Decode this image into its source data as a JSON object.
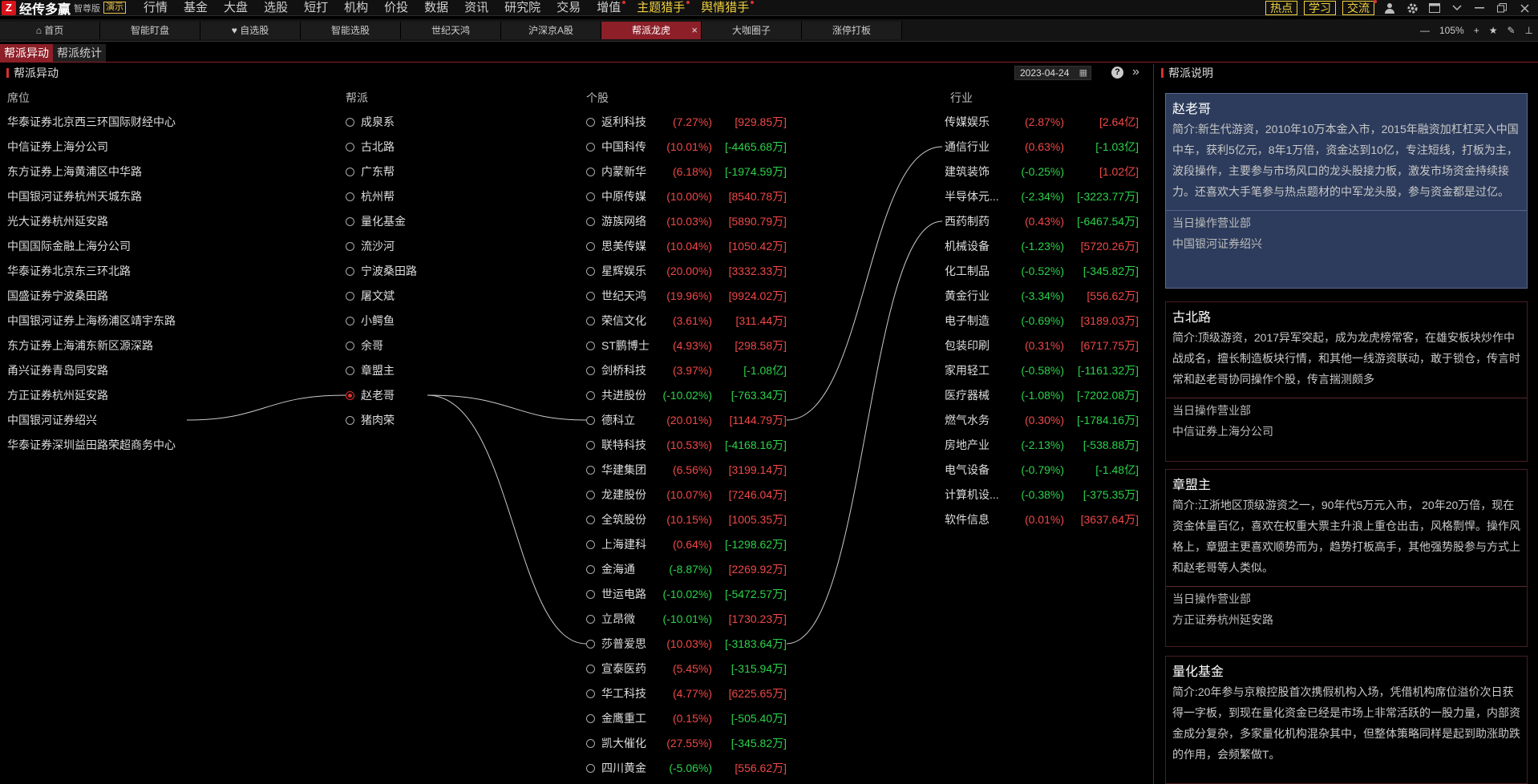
{
  "app": {
    "logo_mark": "Z",
    "name": "经传多赢",
    "edition": "智尊版",
    "demo": "演示"
  },
  "menu": [
    {
      "label": "行情",
      "yellow": false,
      "dot": false
    },
    {
      "label": "基金",
      "yellow": false,
      "dot": false
    },
    {
      "label": "大盘",
      "yellow": false,
      "dot": false
    },
    {
      "label": "选股",
      "yellow": false,
      "dot": false
    },
    {
      "label": "短打",
      "yellow": false,
      "dot": false
    },
    {
      "label": "机构",
      "yellow": false,
      "dot": false
    },
    {
      "label": "价投",
      "yellow": false,
      "dot": false
    },
    {
      "label": "数据",
      "yellow": false,
      "dot": false
    },
    {
      "label": "资讯",
      "yellow": false,
      "dot": false
    },
    {
      "label": "研究院",
      "yellow": false,
      "dot": false
    },
    {
      "label": "交易",
      "yellow": false,
      "dot": false
    },
    {
      "label": "增值",
      "yellow": false,
      "dot": true
    },
    {
      "label": "主题猎手",
      "yellow": true,
      "dot": true
    },
    {
      "label": "舆情猎手",
      "yellow": true,
      "dot": true
    }
  ],
  "top_right": {
    "pills": [
      "热点",
      "学习",
      "交流"
    ]
  },
  "tabs": [
    {
      "label": "首页",
      "icon": "home-icon"
    },
    {
      "label": "智能盯盘"
    },
    {
      "label": "自选股",
      "icon": "heart-icon"
    },
    {
      "label": "智能选股"
    },
    {
      "label": "世纪天鸿"
    },
    {
      "label": "沪深京A股"
    },
    {
      "label": "帮派龙虎",
      "active": true
    },
    {
      "label": "大咖圈子"
    },
    {
      "label": "涨停打板"
    }
  ],
  "zoom": {
    "value": "105%"
  },
  "subtabs": [
    "帮派异动",
    "帮派统计"
  ],
  "main": {
    "section_title": "帮派异动",
    "date": "2023-04-24",
    "help": "?",
    "columns": {
      "seat": "席位",
      "gang": "帮派",
      "stock": "个股",
      "industry": "行业"
    },
    "seats": [
      "华泰证券北京西三环国际财经中心",
      "中信证券上海分公司",
      "东方证券上海黄浦区中华路",
      "中国银河证券杭州天城东路",
      "光大证券杭州延安路",
      "中国国际金融上海分公司",
      "华泰证券北京东三环北路",
      "国盛证券宁波桑田路",
      "中国银河证券上海杨浦区靖宇东路",
      "东方证券上海浦东新区源深路",
      "甬兴证券青岛同安路",
      "方正证券杭州延安路",
      "中国银河证券绍兴",
      "华泰证券深圳益田路荣超商务中心"
    ],
    "gangs": [
      {
        "name": "成泉系",
        "selected": false
      },
      {
        "name": "古北路",
        "selected": false
      },
      {
        "name": "广东帮",
        "selected": false
      },
      {
        "name": "杭州帮",
        "selected": false
      },
      {
        "name": "量化基金",
        "selected": false
      },
      {
        "name": "流沙河",
        "selected": false
      },
      {
        "name": "宁波桑田路",
        "selected": false
      },
      {
        "name": "屠文斌",
        "selected": false
      },
      {
        "name": "小鳄鱼",
        "selected": false
      },
      {
        "name": "余哥",
        "selected": false
      },
      {
        "name": "章盟主",
        "selected": false
      },
      {
        "name": "赵老哥",
        "selected": true
      },
      {
        "name": "猪肉荣",
        "selected": false
      }
    ],
    "stocks": [
      {
        "name": "返利科技",
        "pct": "(7.27%)",
        "amt": "[929.85万]",
        "pct_color": "red",
        "amt_color": "red"
      },
      {
        "name": "中国科传",
        "pct": "(10.01%)",
        "amt": "[-4465.68万]",
        "pct_color": "red",
        "amt_color": "green"
      },
      {
        "name": "内蒙新华",
        "pct": "(6.18%)",
        "amt": "[-1974.59万]",
        "pct_color": "red",
        "amt_color": "green"
      },
      {
        "name": "中原传媒",
        "pct": "(10.00%)",
        "amt": "[8540.78万]",
        "pct_color": "red",
        "amt_color": "red"
      },
      {
        "name": "游族网络",
        "pct": "(10.03%)",
        "amt": "[5890.79万]",
        "pct_color": "red",
        "amt_color": "red"
      },
      {
        "name": "思美传媒",
        "pct": "(10.04%)",
        "amt": "[1050.42万]",
        "pct_color": "red",
        "amt_color": "red"
      },
      {
        "name": "星辉娱乐",
        "pct": "(20.00%)",
        "amt": "[3332.33万]",
        "pct_color": "red",
        "amt_color": "red"
      },
      {
        "name": "世纪天鸿",
        "pct": "(19.96%)",
        "amt": "[9924.02万]",
        "pct_color": "red",
        "amt_color": "red"
      },
      {
        "name": "荣信文化",
        "pct": "(3.61%)",
        "amt": "[311.44万]",
        "pct_color": "red",
        "amt_color": "red"
      },
      {
        "name": "ST鹏博士",
        "pct": "(4.93%)",
        "amt": "[298.58万]",
        "pct_color": "red",
        "amt_color": "red"
      },
      {
        "name": "剑桥科技",
        "pct": "(3.97%)",
        "amt": "[-1.08亿]",
        "pct_color": "red",
        "amt_color": "green"
      },
      {
        "name": "共进股份",
        "pct": "(-10.02%)",
        "amt": "[-763.34万]",
        "pct_color": "green",
        "amt_color": "green"
      },
      {
        "name": "德科立",
        "pct": "(20.01%)",
        "amt": "[1144.79万]",
        "pct_color": "red",
        "amt_color": "red"
      },
      {
        "name": "联特科技",
        "pct": "(10.53%)",
        "amt": "[-4168.16万]",
        "pct_color": "red",
        "amt_color": "green"
      },
      {
        "name": "华建集团",
        "pct": "(6.56%)",
        "amt": "[3199.14万]",
        "pct_color": "red",
        "amt_color": "red"
      },
      {
        "name": "龙建股份",
        "pct": "(10.07%)",
        "amt": "[7246.04万]",
        "pct_color": "red",
        "amt_color": "red"
      },
      {
        "name": "全筑股份",
        "pct": "(10.15%)",
        "amt": "[1005.35万]",
        "pct_color": "red",
        "amt_color": "red"
      },
      {
        "name": "上海建科",
        "pct": "(0.64%)",
        "amt": "[-1298.62万]",
        "pct_color": "red",
        "amt_color": "green"
      },
      {
        "name": "金海通",
        "pct": "(-8.87%)",
        "amt": "[2269.92万]",
        "pct_color": "green",
        "amt_color": "red"
      },
      {
        "name": "世运电路",
        "pct": "(-10.02%)",
        "amt": "[-5472.57万]",
        "pct_color": "green",
        "amt_color": "green"
      },
      {
        "name": "立昂微",
        "pct": "(-10.01%)",
        "amt": "[1730.23万]",
        "pct_color": "green",
        "amt_color": "red"
      },
      {
        "name": "莎普爱思",
        "pct": "(10.03%)",
        "amt": "[-3183.64万]",
        "pct_color": "red",
        "amt_color": "green"
      },
      {
        "name": "宣泰医药",
        "pct": "(5.45%)",
        "amt": "[-315.94万]",
        "pct_color": "red",
        "amt_color": "green"
      },
      {
        "name": "华工科技",
        "pct": "(4.77%)",
        "amt": "[6225.65万]",
        "pct_color": "red",
        "amt_color": "red"
      },
      {
        "name": "金鹰重工",
        "pct": "(0.15%)",
        "amt": "[-505.40万]",
        "pct_color": "red",
        "amt_color": "green"
      },
      {
        "name": "凯大催化",
        "pct": "(27.55%)",
        "amt": "[-345.82万]",
        "pct_color": "red",
        "amt_color": "green"
      },
      {
        "name": "四川黄金",
        "pct": "(-5.06%)",
        "amt": "[556.62万]",
        "pct_color": "green",
        "amt_color": "red"
      }
    ],
    "industries": [
      {
        "name": "传媒娱乐",
        "pct": "(2.87%)",
        "amt": "[2.64亿]",
        "pct_color": "red",
        "amt_color": "red"
      },
      {
        "name": "通信行业",
        "pct": "(0.63%)",
        "amt": "[-1.03亿]",
        "pct_color": "red",
        "amt_color": "green"
      },
      {
        "name": "建筑装饰",
        "pct": "(-0.25%)",
        "amt": "[1.02亿]",
        "pct_color": "green",
        "amt_color": "red"
      },
      {
        "name": "半导体元...",
        "pct": "(-2.34%)",
        "amt": "[-3223.77万]",
        "pct_color": "green",
        "amt_color": "green"
      },
      {
        "name": "西药制药",
        "pct": "(0.43%)",
        "amt": "[-6467.54万]",
        "pct_color": "red",
        "amt_color": "green"
      },
      {
        "name": "机械设备",
        "pct": "(-1.23%)",
        "amt": "[5720.26万]",
        "pct_color": "green",
        "amt_color": "red"
      },
      {
        "name": "化工制品",
        "pct": "(-0.52%)",
        "amt": "[-345.82万]",
        "pct_color": "green",
        "amt_color": "green"
      },
      {
        "name": "黄金行业",
        "pct": "(-3.34%)",
        "amt": "[556.62万]",
        "pct_color": "green",
        "amt_color": "red"
      },
      {
        "name": "电子制造",
        "pct": "(-0.69%)",
        "amt": "[3189.03万]",
        "pct_color": "green",
        "amt_color": "red"
      },
      {
        "name": "包装印刷",
        "pct": "(0.31%)",
        "amt": "[6717.75万]",
        "pct_color": "red",
        "amt_color": "red"
      },
      {
        "name": "家用轻工",
        "pct": "(-0.58%)",
        "amt": "[-1161.32万]",
        "pct_color": "green",
        "amt_color": "green"
      },
      {
        "name": "医疗器械",
        "pct": "(-1.08%)",
        "amt": "[-7202.08万]",
        "pct_color": "green",
        "amt_color": "green"
      },
      {
        "name": "燃气水务",
        "pct": "(0.30%)",
        "amt": "[-1784.16万]",
        "pct_color": "red",
        "amt_color": "green"
      },
      {
        "name": "房地产业",
        "pct": "(-2.13%)",
        "amt": "[-538.88万]",
        "pct_color": "green",
        "amt_color": "green"
      },
      {
        "name": "电气设备",
        "pct": "(-0.79%)",
        "amt": "[-1.48亿]",
        "pct_color": "green",
        "amt_color": "green"
      },
      {
        "name": "计算机设...",
        "pct": "(-0.38%)",
        "amt": "[-375.35万]",
        "pct_color": "green",
        "amt_color": "green"
      },
      {
        "name": "软件信息",
        "pct": "(0.01%)",
        "amt": "[3637.64万]",
        "pct_color": "red",
        "amt_color": "red"
      }
    ]
  },
  "side": {
    "section_title": "帮派说明",
    "cards": [
      {
        "title": "赵老哥",
        "desc": "简介:新生代游资，2010年10万本金入市，2015年融资加杠杠买入中国中车，获利5亿元，8年1万倍，资金达到10亿，专注短线，打板为主，波段操作，主要参与市场风口的龙头股接力板，激发市场资金持续接力。还喜欢大手笔参与热点题材的中军龙头股，参与资金都是过亿。",
        "sub_label": "当日操作营业部",
        "sub_value": "中国银河证券绍兴",
        "selected": true
      },
      {
        "title": "古北路",
        "desc": "简介:顶级游资，2017异军突起，成为龙虎榜常客，在雄安板块炒作中战成名，擅长制造板块行情，和其他一线游资联动，敢于锁仓，传言时常和赵老哥协同操作个股，传言揣测颇多",
        "sub_label": "当日操作营业部",
        "sub_value": "中信证券上海分公司",
        "selected": false
      },
      {
        "title": "章盟主",
        "desc": "简介:江浙地区顶级游资之一，90年代5万元入市， 20年20万倍，现在资金体量百亿，喜欢在权重大票主升浪上重仓出击，风格剽悍。操作风格上，章盟主更喜欢顺势而为，趋势打板高手，其他强势股参与方式上和赵老哥等人类似。",
        "sub_label": "当日操作营业部",
        "sub_value": "方正证券杭州延安路",
        "selected": false
      },
      {
        "title": "量化基金",
        "desc": "简介:20年参与京粮控股首次携假机构入场，凭借机构席位溢价次日获得一字板，到现在量化资金已经是市场上非常活跃的一股力量，内部资金成分复杂，多家量化机构混杂其中，但整体策略同样是起到助涨助跌的作用，会频繁做T。",
        "sub_label": "",
        "sub_value": "",
        "selected": false
      }
    ]
  },
  "colors": {
    "up": "#f04848",
    "down": "#2cd24a",
    "accent": "#8c1f28"
  }
}
